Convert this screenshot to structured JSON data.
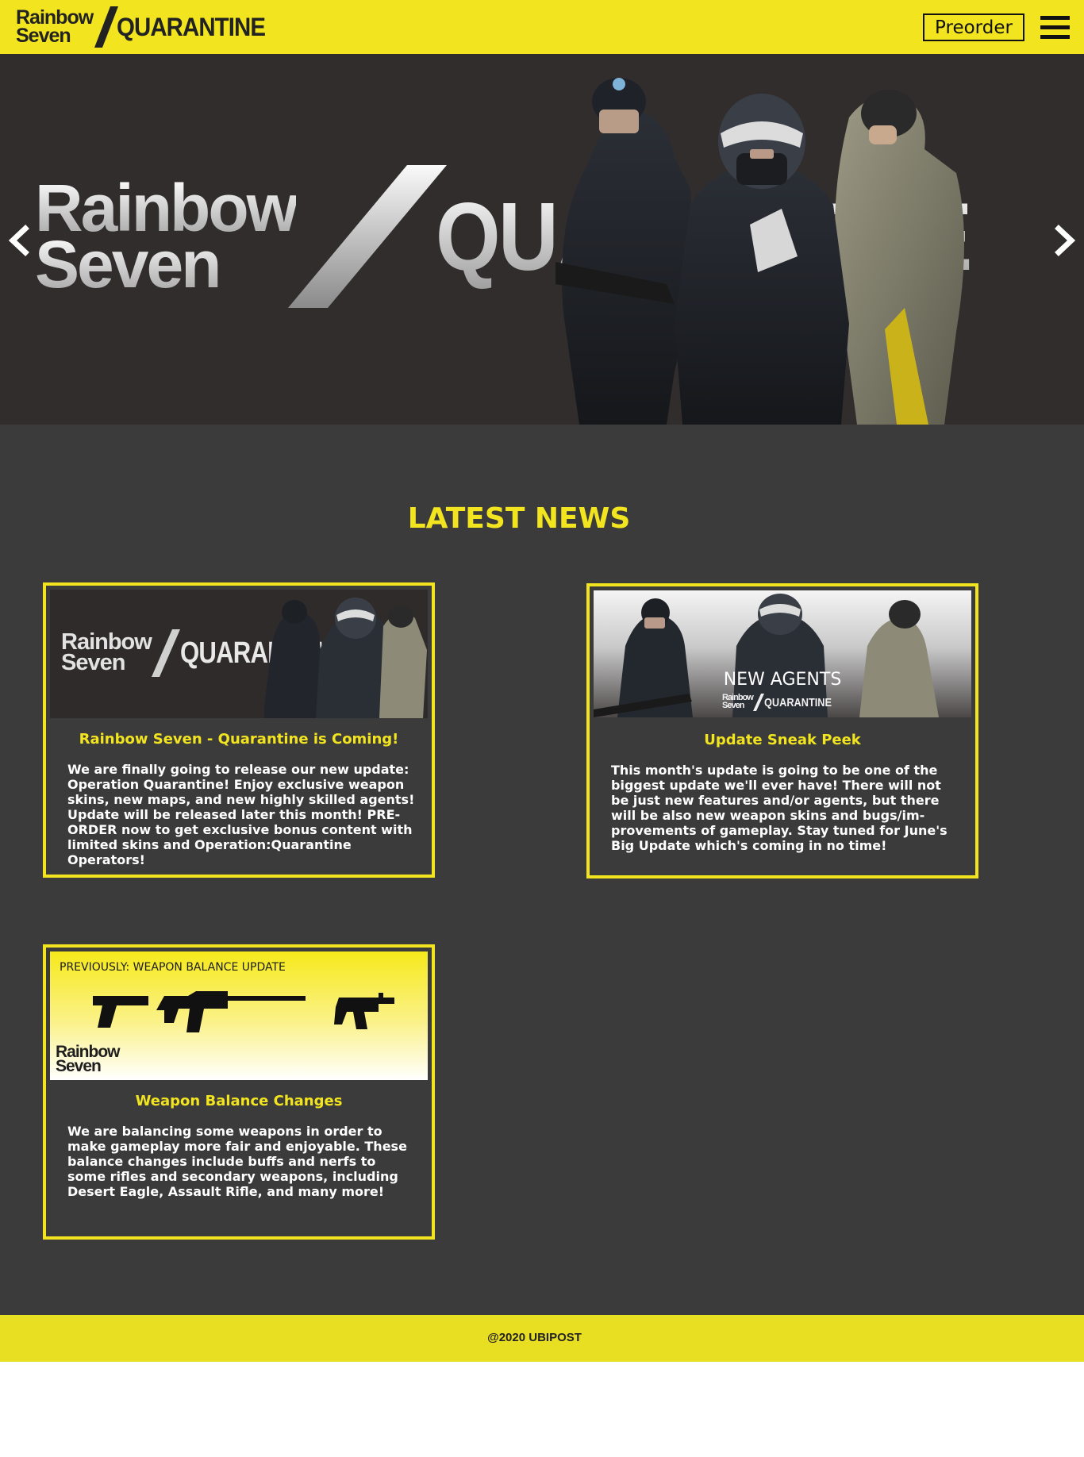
{
  "header": {
    "logo": {
      "line1": "Rainbow",
      "line2": "Seven",
      "word": "QUARANTINE"
    },
    "preorder_label": "Preorder",
    "menu_icon": "hamburger-menu-icon"
  },
  "hero": {
    "title_line1": "Rainbow",
    "title_line2": "Seven",
    "title_word": "QUARANTINE",
    "prev_icon": "chevron-left-icon",
    "next_icon": "chevron-right-icon"
  },
  "news": {
    "heading": "LATEST NEWS",
    "cards": [
      {
        "image_logo_line1": "Rainbow",
        "image_logo_line2": "Seven",
        "image_logo_word": "QUARANTINE",
        "title": "Rainbow Seven - Quarantine is Coming!",
        "text": "We are finally going to release our new update: Operation Quarantine! Enjoy exclusive weapon skins, new maps, and new highly skilled agents! Update will be released later this month! PRE-ORDER now to get exclusive bonus content with limited skins and Operation:Quarantine Operators!"
      },
      {
        "image_caption": "NEW AGENTS",
        "image_logo_line1": "Rainbow",
        "image_logo_line2": "Seven",
        "image_logo_word": "QUARANTINE",
        "title": "Update Sneak Peek",
        "text": "This month's update is going to be one of the biggest update we'll ever have! There will not be just new features and/or agents, but there will be also new weapon skins and bugs/im-provements of gameplay. Stay tuned for June's Big Update which's coming in no time!"
      },
      {
        "image_caption": "PREVIOUSLY: WEAPON BALANCE UPDATE",
        "image_logo_line1": "Rainbow",
        "image_logo_line2": "Seven",
        "title": "Weapon Balance Changes",
        "text": "We are balancing some weapons in order to make gameplay more fair and enjoyable. These balance changes include buffs and nerfs to some rifles and secondary weapons, including Desert Eagle, Assault Rifle, and many more!"
      }
    ]
  },
  "footer": {
    "copyright": "@2020 UBIPOST"
  },
  "colors": {
    "accent": "#f2e51f",
    "background": "#3c3b3c",
    "hero_bg": "#322d2d",
    "footer": "#e9df22"
  }
}
